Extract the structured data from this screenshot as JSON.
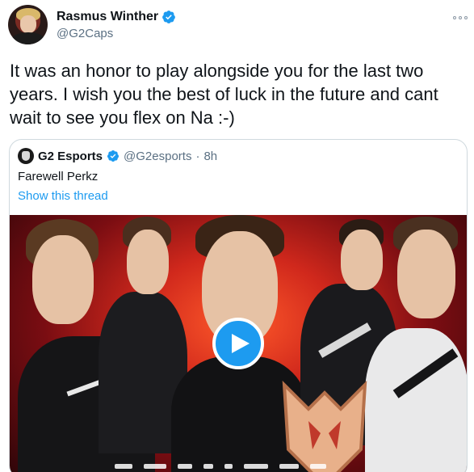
{
  "author": {
    "name": "Rasmus Winther",
    "handle": "@G2Caps"
  },
  "tweet": {
    "text": "It was an honor to play alongside you for the last two years. I wish you the best of luck in the future and cant wait to see you flex on Na :-)"
  },
  "quoted": {
    "name": "G2 Esports",
    "handle": "@G2esports",
    "separator": "·",
    "time": "8h",
    "text": "Farewell Perkz",
    "thread_link": "Show this thread"
  },
  "media": {
    "type": "video",
    "play_icon": "play-icon"
  },
  "colors": {
    "accent": "#1d9bf0",
    "secondary_text": "#5b7083",
    "border": "#cfd9de"
  },
  "icons": {
    "verified": "verified-badge-icon",
    "more": "more-options-icon"
  }
}
